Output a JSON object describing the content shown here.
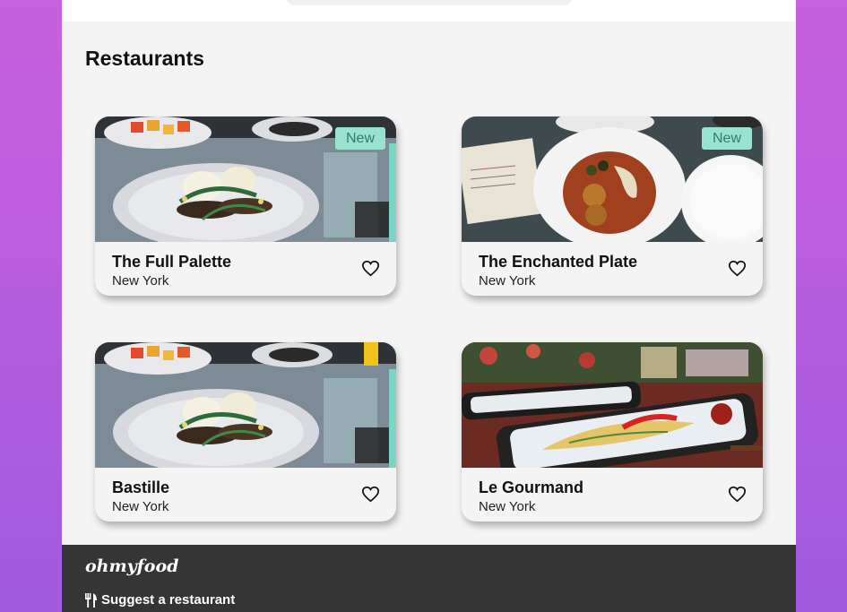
{
  "header": {
    "search_placeholder": ""
  },
  "section": {
    "title": "Restaurants"
  },
  "restaurants": [
    {
      "name": "The Full Palette",
      "city": "New York",
      "badge": "New"
    },
    {
      "name": "The Enchanted Plate",
      "city": "New York",
      "badge": "New"
    },
    {
      "name": "Bastille",
      "city": "New York",
      "badge": ""
    },
    {
      "name": "Le Gourmand",
      "city": "New York",
      "badge": ""
    }
  ],
  "footer": {
    "logo": "ohmyfood",
    "suggest_label": "Suggest a restaurant"
  },
  "colors": {
    "background_gradient_top": "#c960dd",
    "background_gradient_bottom": "#a15ae0",
    "badge_bg": "#99e2d0",
    "badge_text": "#2f7c68",
    "footer_bg": "#353535"
  },
  "icons": {
    "favorite": "heart-outline-icon",
    "suggest": "utensils-icon"
  }
}
